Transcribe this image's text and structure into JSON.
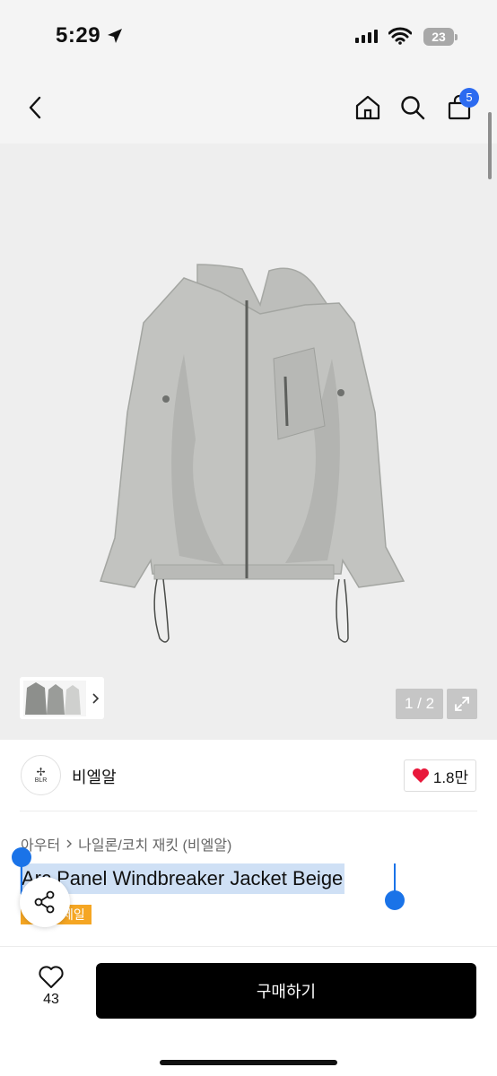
{
  "status_bar": {
    "time": "5:29",
    "battery": "23"
  },
  "nav": {
    "cart_count": "5"
  },
  "gallery": {
    "page_indicator": "1 / 2"
  },
  "brand": {
    "name": "비엘알",
    "logo_text": "BLR",
    "likes": "1.8만"
  },
  "product": {
    "category": "아우터",
    "subcategory": "나일론/코치 재킷 (비엘알)",
    "title": "Arc Panel Windbreaker Jacket Beige",
    "tag": "세일"
  },
  "bottom_bar": {
    "wish_count": "43",
    "buy_label": "구매하기"
  },
  "colors": {
    "accent": "#2c6bf0",
    "selection": "#cfe0f5",
    "tag": "#f5a623",
    "like_heart": "#e8183b"
  }
}
